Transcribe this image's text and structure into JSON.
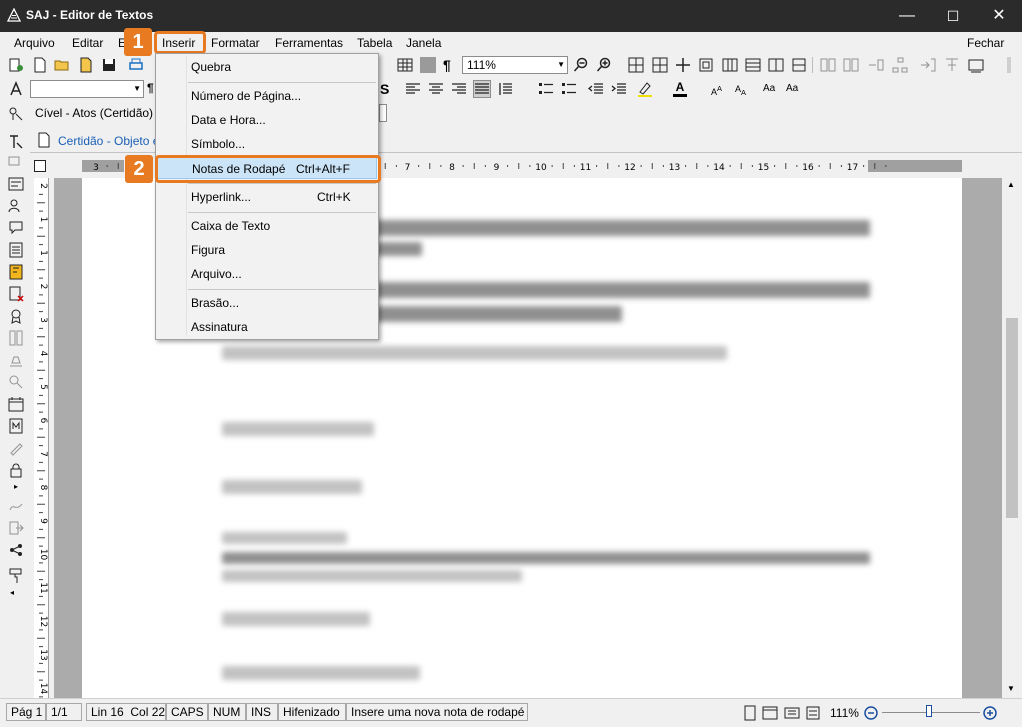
{
  "window": {
    "title": "SAJ - Editor de Textos",
    "minimize_glyph": "—",
    "maximize_glyph": "☐",
    "close_glyph": "✕"
  },
  "menubar": {
    "items": [
      {
        "label": "Arquivo"
      },
      {
        "label": "Editar"
      },
      {
        "label": "E"
      },
      {
        "label": "Inserir"
      },
      {
        "label": "Formatar"
      },
      {
        "label": "Ferramentas"
      },
      {
        "label": "Tabela"
      },
      {
        "label": "Janela"
      }
    ],
    "right_label": "Fechar"
  },
  "toolbar": {
    "zoom_value": "111%",
    "document_tree": "Cível - Atos (Certidão)",
    "doc_tab": "Certidão - Objeto e"
  },
  "insert_menu": {
    "items": [
      {
        "label": "Quebra",
        "shortcut": ""
      },
      {
        "label": "Número de Página...",
        "shortcut": ""
      },
      {
        "label": "Data e Hora...",
        "shortcut": ""
      },
      {
        "label": "Símbolo...",
        "shortcut": ""
      },
      {
        "label": "Notas de Rodapé",
        "shortcut": "Ctrl+Alt+F"
      },
      {
        "label": "Hyperlink...",
        "shortcut": "Ctrl+K"
      },
      {
        "label": "Caixa de Texto",
        "shortcut": ""
      },
      {
        "label": "Figura",
        "shortcut": ""
      },
      {
        "label": "Arquivo...",
        "shortcut": ""
      },
      {
        "label": "Brasão...",
        "shortcut": ""
      },
      {
        "label": "Assinatura",
        "shortcut": ""
      }
    ],
    "highlighted": "Notas de Rodapé"
  },
  "callouts": {
    "step1": "1",
    "step2": "2"
  },
  "ruler": {
    "ticks": [
      "3",
      "1",
      "2",
      "3",
      "4",
      "5",
      "6",
      "7",
      "8",
      "9",
      "10",
      "11",
      "12",
      "13",
      "14",
      "15",
      "16",
      "17"
    ]
  },
  "vruler": {
    "ticks": [
      "2",
      "1",
      "1",
      "2",
      "3",
      "4",
      "5",
      "6",
      "7",
      "8",
      "9",
      "10",
      "11",
      "12",
      "13",
      "14"
    ]
  },
  "statusbar": {
    "page": "Pág 1",
    "pages": "1/1",
    "position": "Lin 16  Col 22",
    "caps": "CAPS",
    "num": "NUM",
    "ins": "INS",
    "hyphen": "Hifenizado",
    "message": "Insere uma nova nota de rodapé",
    "zoom": "111%"
  },
  "colors": {
    "accent": "#e87a22",
    "highlight": "#cce4f7",
    "titlebar": "#2b2b2b"
  }
}
